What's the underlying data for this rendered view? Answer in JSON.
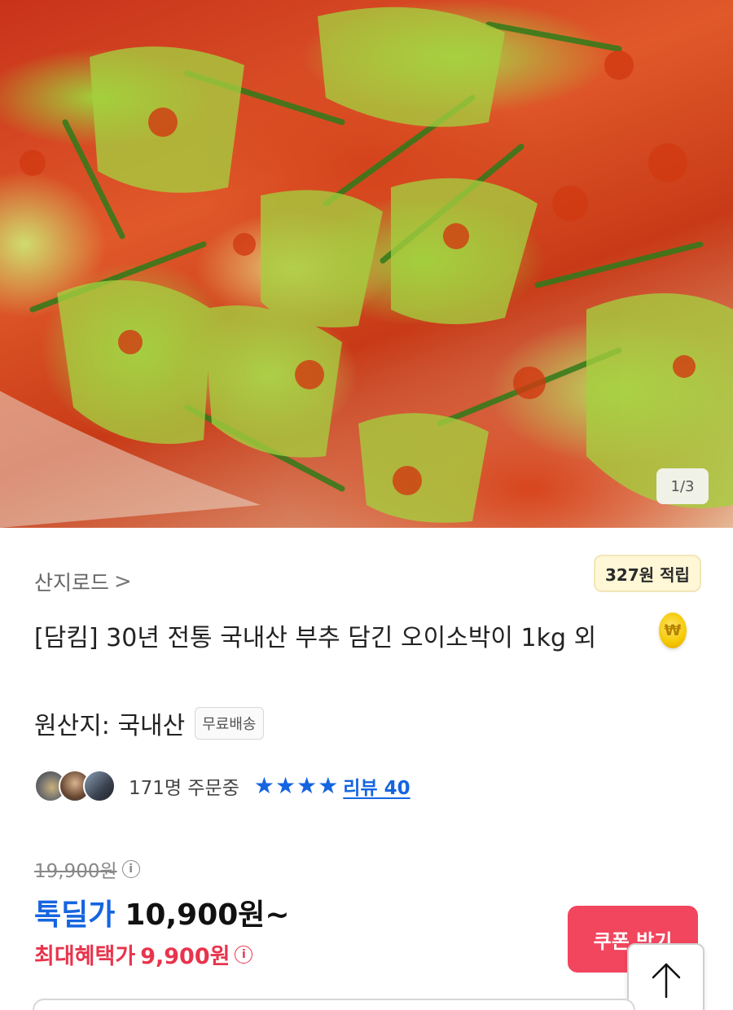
{
  "gallery": {
    "page_indicator": "1/3",
    "image_alt": "오이소박이"
  },
  "product": {
    "seller": "산지로드",
    "seller_chevron": ">",
    "title": "[담킴] 30년 전통 국내산 부추 담긴 오이소박이 1kg 외",
    "origin": "원산지: 국내산",
    "shipping_badge": "무료배송"
  },
  "rewards": {
    "points_text": "327원 적립",
    "coin_symbol": "₩"
  },
  "social": {
    "order_count": "171명 주문중",
    "rating": 4,
    "review_link": "리뷰 40"
  },
  "pricing": {
    "original_price": "19,900원",
    "sale_label": "톡딜가",
    "sale_price": "10,900원~",
    "max_benefit_label": "최대혜택가",
    "max_benefit_price": "9,900원",
    "info_symbol": "i"
  },
  "actions": {
    "coupon_button": "쿠폰 받기"
  },
  "colors": {
    "accent_blue": "#1565e0",
    "accent_red": "#f2455e",
    "max_red": "#e8344c"
  }
}
